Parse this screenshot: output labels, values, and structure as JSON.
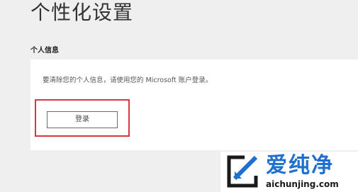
{
  "page": {
    "title": "个性化设置"
  },
  "personal_info": {
    "heading": "个人信息",
    "message": "要清除您的个人信息，请使用您的 Microsoft 账户登录。",
    "login_button_label": "登录"
  },
  "watermark": {
    "brand": "爱纯净",
    "domain": "aichunjing.com",
    "logo_icon": "aichunjing-logo-icon"
  },
  "colors": {
    "highlight": "#d9363e",
    "brand": "#1f6fcf"
  }
}
